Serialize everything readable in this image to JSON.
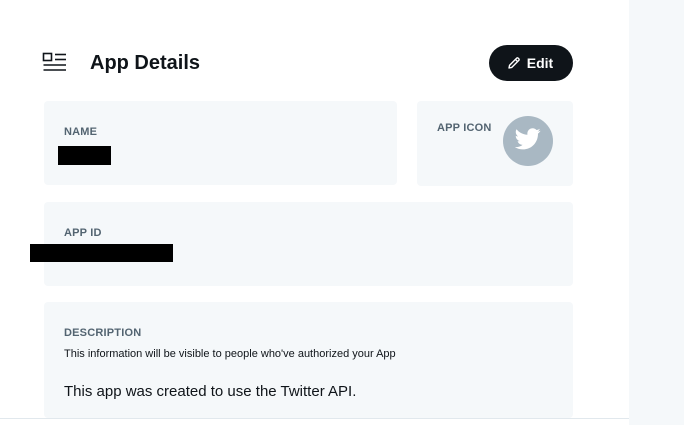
{
  "header": {
    "title": "App Details",
    "icon": "details-list-icon",
    "edit_label": "Edit",
    "edit_icon": "pencil-icon"
  },
  "fields": {
    "name": {
      "label": "NAME",
      "value_redacted": true
    },
    "app_icon": {
      "label": "APP ICON",
      "icon": "twitter-bird-icon",
      "avatar_color": "#a9b8c3"
    },
    "app_id": {
      "label": "APP ID",
      "value_redacted": true
    },
    "description": {
      "label": "DESCRIPTION",
      "help_text": "This information will be visible to people who've authorized your App",
      "value": "This app was created to use the Twitter API."
    }
  },
  "colors": {
    "primary_button": "#0f1419",
    "card_background": "#f5f8fa",
    "label_text": "#536471",
    "side_panel": "#f5f8fa"
  }
}
